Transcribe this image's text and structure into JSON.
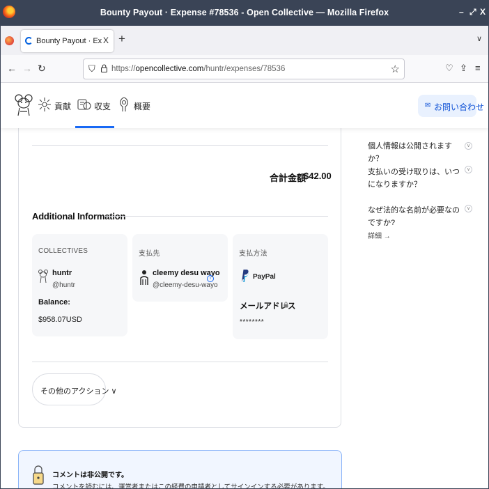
{
  "browser": {
    "window_title": "Bounty Payout · Expense #78536 - Open Collective — Mozilla Firefox",
    "window_controls": {
      "minimize": "–",
      "restore": "⤢",
      "close": "X"
    },
    "tab": {
      "title": "Bounty Payout · Expense #",
      "close": "X"
    },
    "new_tab": "+",
    "tab_list": "∨",
    "url": {
      "scheme": "https://",
      "domain": "opencollective.com",
      "path": "/huntr/expenses/78536"
    }
  },
  "site": {
    "nav": [
      {
        "label": "貢献"
      },
      {
        "label": "収支"
      },
      {
        "label": "概要"
      }
    ],
    "contact_button": "お問い合わせ"
  },
  "expense": {
    "total_label": "合計金額",
    "total_value": "$42.00",
    "additional_info_title": "Additional Information",
    "collective": {
      "heading": "COLLECTIVES",
      "name": "huntr",
      "handle": "@huntr",
      "balance_label": "Balance:",
      "balance_value": "$958.07USD"
    },
    "payee": {
      "heading": "支払先",
      "name": "cleemy desu wayo",
      "handle": "@cleemy-desu-wayo"
    },
    "payout_method": {
      "heading": "支払方法",
      "provider": "PayPal",
      "email_label": "メールアドレス",
      "email_value": "********"
    },
    "more_actions": "その他のアクション"
  },
  "faq": {
    "items": [
      "個人情報は公開されますか？",
      "支払いの受け取りは、いつになりますか？",
      "なぜ法的な名前が必要なのですか?"
    ],
    "more_link": "詳細 →"
  },
  "comment_notice": {
    "title": "コメントは非公開です。",
    "body": "コメントを読むには、運営者またはこの経費の申請者としてサインインする必要があります。"
  },
  "colors": {
    "accent": "#1869f5",
    "titlebar": "#3a4456",
    "contact_bg": "#e9f1fe"
  }
}
